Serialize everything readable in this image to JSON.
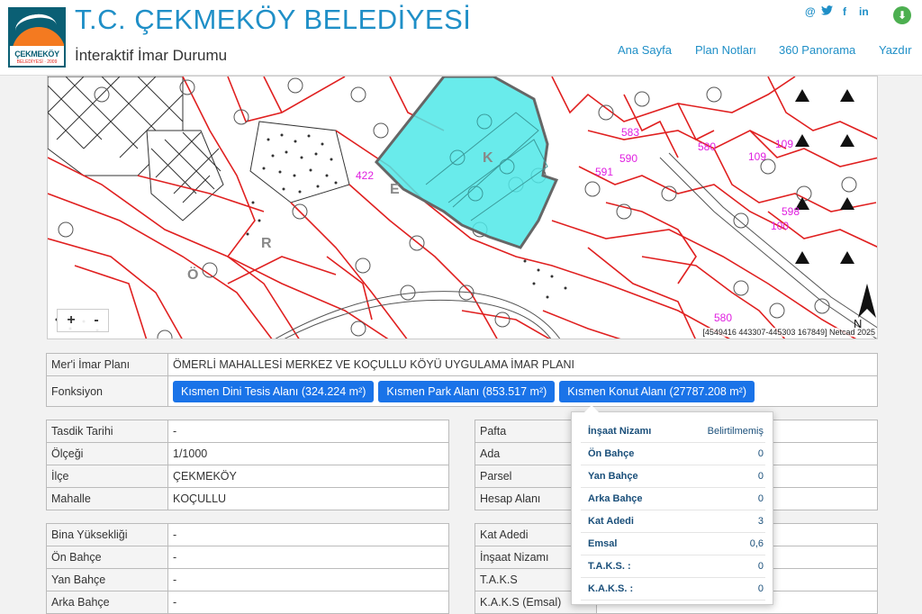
{
  "header": {
    "logo_text": "ÇEKMEKÖY",
    "logo_sub": "BELEDİYESİ · 2009",
    "title": "T.C. ÇEKMEKÖY BELEDİYESİ",
    "subtitle": "İnteraktif İmar Durumu",
    "nav": [
      "Ana Sayfa",
      "Plan Notları",
      "360 Panorama",
      "Yazdır"
    ],
    "social_icons": [
      "at-icon",
      "twitter-icon",
      "facebook-icon",
      "linkedin-icon",
      "download-icon"
    ]
  },
  "map": {
    "zoom_in": "+",
    "zoom_out": "-",
    "coordinates": "[4549416 443307-445303 167849] Netcad 2025",
    "north_label": "N",
    "parcel_labels": [
      "422",
      "583",
      "580",
      "590",
      "591",
      "109",
      "109",
      "598",
      "100",
      "580"
    ],
    "map_letters": [
      "E",
      "K",
      "R",
      "Ö"
    ]
  },
  "plan": {
    "label_plan": "Mer'i İmar Planı",
    "plan_value": "ÖMERLİ MAHALLESİ MERKEZ VE KOÇULLU KÖYÜ UYGULAMA İMAR PLANI",
    "label_function": "Fonksiyon",
    "functions": [
      "Kısmen Dini Tesis Alanı (324.224 m²)",
      "Kısmen Park Alanı (853.517 m²)",
      "Kısmen Konut Alanı (27787.208 m²)"
    ]
  },
  "info_left": [
    {
      "label": "Tasdik Tarihi",
      "value": "-"
    },
    {
      "label": "Ölçeği",
      "value": "1/1000"
    },
    {
      "label": "İlçe",
      "value": "ÇEKMEKÖY"
    },
    {
      "label": "Mahalle",
      "value": "KOÇULLU"
    }
  ],
  "info_right": [
    {
      "label": "Pafta",
      "value": ""
    },
    {
      "label": "Ada",
      "value": ""
    },
    {
      "label": "Parsel",
      "value": ""
    },
    {
      "label": "Hesap Alanı",
      "value": ""
    }
  ],
  "build_left": [
    {
      "label": "Bina Yüksekliği",
      "value": "-"
    },
    {
      "label": "Ön Bahçe",
      "value": "-"
    },
    {
      "label": "Yan Bahçe",
      "value": "-"
    },
    {
      "label": "Arka Bahçe",
      "value": "-"
    }
  ],
  "build_right": [
    {
      "label": "Kat Adedi",
      "value": ""
    },
    {
      "label": "İnşaat Nizamı",
      "value": ""
    },
    {
      "label": "T.A.K.S",
      "value": ""
    },
    {
      "label": "K.A.K.S (Emsal)",
      "value": ""
    }
  ],
  "popup": [
    {
      "label": "İnşaat Nizamı",
      "value": "Belirtilmemiş"
    },
    {
      "label": "Ön Bahçe",
      "value": "0"
    },
    {
      "label": "Yan Bahçe",
      "value": "0"
    },
    {
      "label": "Arka Bahçe",
      "value": "0"
    },
    {
      "label": "Kat Adedi",
      "value": "3"
    },
    {
      "label": "Emsal",
      "value": "0,6"
    },
    {
      "label": "T.A.K.S. :",
      "value": "0"
    },
    {
      "label": "K.A.K.S. :",
      "value": "0"
    }
  ]
}
